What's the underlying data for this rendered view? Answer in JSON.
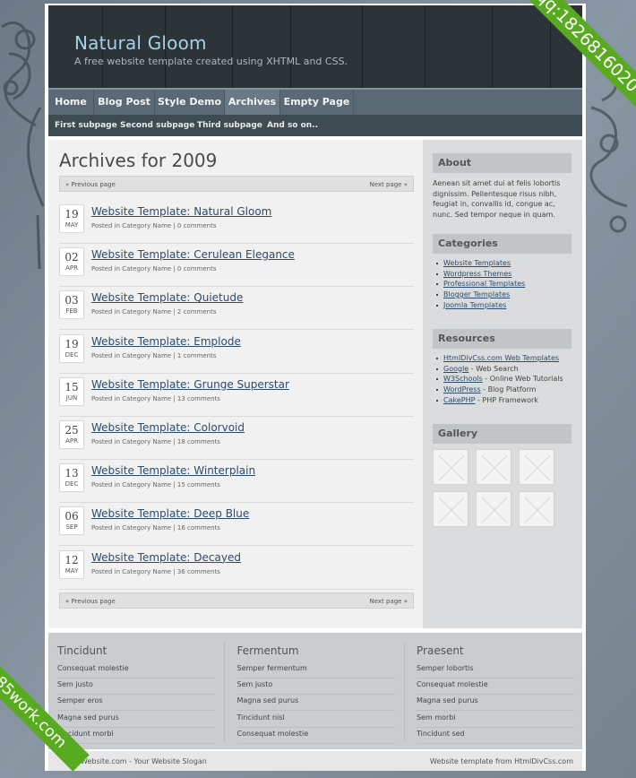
{
  "header": {
    "site_title": "Natural Gloom",
    "slogan": "A free website template created using XHTML and CSS."
  },
  "nav": {
    "items": [
      "Home",
      "Blog Post",
      "Style Demo",
      "Archives",
      "Empty Page"
    ],
    "active": "Archives"
  },
  "subnav": {
    "items": [
      "First subpage",
      "Second subpage",
      "Third subpage",
      "And so on.."
    ]
  },
  "archives": {
    "title": "Archives for 2009",
    "prev_label": "« Previous page",
    "next_label": "Next page »",
    "meta_prefix": "Posted in",
    "posts": [
      {
        "day": "19",
        "month": "MAY",
        "title": "Website Template: Natural Gloom",
        "category": "Category Name",
        "comments": "0 comments"
      },
      {
        "day": "02",
        "month": "APR",
        "title": "Website Template: Cerulean Elegance",
        "category": "Category Name",
        "comments": "0 comments"
      },
      {
        "day": "03",
        "month": "FEB",
        "title": "Website Template: Quietude",
        "category": "Category Name",
        "comments": "2 comments"
      },
      {
        "day": "19",
        "month": "DEC",
        "title": "Website Template: Emplode",
        "category": "Category Name",
        "comments": "1 comments"
      },
      {
        "day": "15",
        "month": "JUN",
        "title": "Website Template: Grunge Superstar",
        "category": "Category Name",
        "comments": "13 comments"
      },
      {
        "day": "25",
        "month": "APR",
        "title": "Website Template: Colorvoid",
        "category": "Category Name",
        "comments": "18 comments"
      },
      {
        "day": "13",
        "month": "DEC",
        "title": "Website Template: Winterplain",
        "category": "Category Name",
        "comments": "15 comments"
      },
      {
        "day": "06",
        "month": "SEP",
        "title": "Website Template: Deep Blue",
        "category": "Category Name",
        "comments": "16 comments"
      },
      {
        "day": "12",
        "month": "MAY",
        "title": "Website Template: Decayed",
        "category": "Category Name",
        "comments": "36 comments"
      }
    ]
  },
  "sidebar": {
    "about": {
      "title": "About",
      "text": "Aenean sit amet dui at felis lobortis dignissim. Pellentesque risus nibh, feugiat in, convallis id, congue ac, nunc. Sed tempor neque in quam."
    },
    "categories": {
      "title": "Categories",
      "items": [
        "Website Templates",
        "Wordpress Themes",
        "Professional Templates",
        "Blogger Templates",
        "Joomla Templates"
      ]
    },
    "resources": {
      "title": "Resources",
      "items": [
        {
          "link": "HtmlDivCss.com Web Templates",
          "desc": ""
        },
        {
          "link": "Google",
          "desc": " - Web Search"
        },
        {
          "link": "W3Schools",
          "desc": " - Online Web Tutorials"
        },
        {
          "link": "WordPress",
          "desc": " - Blog Platform"
        },
        {
          "link": "CakePHP",
          "desc": " - PHP Framework"
        }
      ]
    },
    "gallery": {
      "title": "Gallery",
      "count": 6
    }
  },
  "footer": {
    "columns": [
      {
        "title": "Tincidunt",
        "links": [
          "Consequat molestie",
          "Sem justo",
          "Semper eros",
          "Magna sed purus",
          "Tincidunt morbi"
        ]
      },
      {
        "title": "Fermentum",
        "links": [
          "Semper fermentum",
          "Sem justo",
          "Magna sed purus",
          "Tincidunt nisl",
          "Consequat molestie"
        ]
      },
      {
        "title": "Praesent",
        "links": [
          "Semper lobortis",
          "Consequat molestie",
          "Magna sed purus",
          "Sem morbi",
          "Tincidunt sed"
        ]
      }
    ],
    "bottom_left": "Website.com - Your Website Slogan",
    "bottom_right": "Website template from HtmlDivCss.com"
  },
  "watermarks": {
    "top_right": "qq:1826816020",
    "bottom_left": "85work.com"
  },
  "colors": {
    "link": "#2d4c6b",
    "nav_bg": "#5a6a74",
    "ribbon": "#58aa1f"
  }
}
